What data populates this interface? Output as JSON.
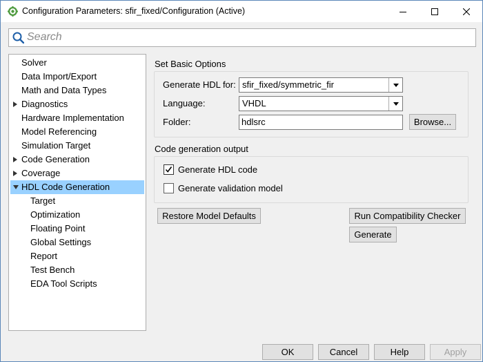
{
  "window": {
    "title": "Configuration Parameters: sfir_fixed/Configuration (Active)",
    "controls": [
      "minimize",
      "maximize",
      "close"
    ]
  },
  "search": {
    "placeholder": "Search",
    "value": ""
  },
  "tree": {
    "items": [
      {
        "label": "Solver",
        "expander": "none",
        "indent": 0
      },
      {
        "label": "Data Import/Export",
        "expander": "none",
        "indent": 0
      },
      {
        "label": "Math and Data Types",
        "expander": "none",
        "indent": 0
      },
      {
        "label": "Diagnostics",
        "expander": "collapsed",
        "indent": 0
      },
      {
        "label": "Hardware Implementation",
        "expander": "none",
        "indent": 0
      },
      {
        "label": "Model Referencing",
        "expander": "none",
        "indent": 0
      },
      {
        "label": "Simulation Target",
        "expander": "none",
        "indent": 0
      },
      {
        "label": "Code Generation",
        "expander": "collapsed",
        "indent": 0
      },
      {
        "label": "Coverage",
        "expander": "collapsed",
        "indent": 0
      },
      {
        "label": "HDL Code Generation",
        "expander": "expanded",
        "indent": 0,
        "selected": true
      },
      {
        "label": "Target",
        "expander": "none",
        "indent": 1
      },
      {
        "label": "Optimization",
        "expander": "none",
        "indent": 1
      },
      {
        "label": "Floating Point",
        "expander": "none",
        "indent": 1
      },
      {
        "label": "Global Settings",
        "expander": "none",
        "indent": 1
      },
      {
        "label": "Report",
        "expander": "none",
        "indent": 1
      },
      {
        "label": "Test Bench",
        "expander": "none",
        "indent": 1
      },
      {
        "label": "EDA Tool Scripts",
        "expander": "none",
        "indent": 1
      }
    ]
  },
  "basic_options": {
    "title": "Set Basic Options",
    "generate_for_label": "Generate HDL for:",
    "generate_for_value": "sfir_fixed/symmetric_fir",
    "language_label": "Language:",
    "language_value": "VHDL",
    "folder_label": "Folder:",
    "folder_value": "hdlsrc",
    "browse_label": "Browse..."
  },
  "codegen_output": {
    "title": "Code generation output",
    "generate_hdl_label": "Generate HDL code",
    "generate_hdl_checked": true,
    "validation_label": "Generate validation model",
    "validation_checked": false
  },
  "actions": {
    "restore_label": "Restore Model Defaults",
    "compat_label": "Run Compatibility Checker",
    "generate_label": "Generate"
  },
  "footer": {
    "ok": "OK",
    "cancel": "Cancel",
    "help": "Help",
    "apply": "Apply",
    "apply_enabled": false
  },
  "colors": {
    "selection": "#99d1ff",
    "window_bg": "#f0f0f0",
    "button_bg": "#e1e1e1"
  }
}
